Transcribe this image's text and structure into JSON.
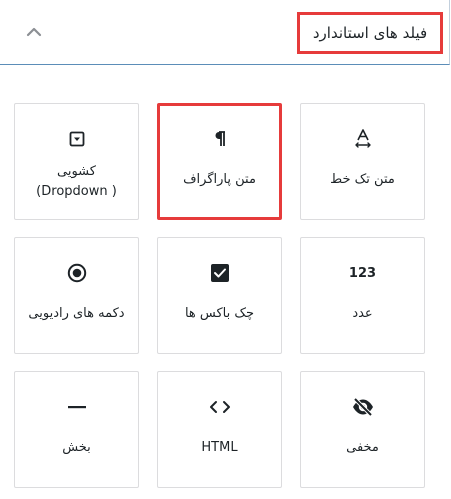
{
  "section": {
    "title": "فیلد های استاندارد",
    "collapse_icon": "chevron-up-icon"
  },
  "fields": [
    {
      "label": "متن تک خط",
      "icon": "text-single-line-icon"
    },
    {
      "label": "متن پاراگراف",
      "icon": "paragraph-icon",
      "highlighted": true
    },
    {
      "label": "کشویی\n( Dropdown)",
      "icon": "dropdown-icon"
    },
    {
      "label": "عدد",
      "icon": "number-icon",
      "icon_text": "123"
    },
    {
      "label": "چک باکس ها",
      "icon": "checkbox-icon"
    },
    {
      "label": "دکمه های رادیویی",
      "icon": "radio-icon"
    },
    {
      "label": "مخفی",
      "icon": "eye-slash-icon"
    },
    {
      "label": "HTML",
      "icon": "code-icon"
    },
    {
      "label": "بخش",
      "icon": "section-divider-icon"
    }
  ],
  "colors": {
    "highlight": "#e63b3b",
    "header_border": "#5b8db8",
    "tile_border": "#dcdcde",
    "icon": "#1d2327"
  }
}
